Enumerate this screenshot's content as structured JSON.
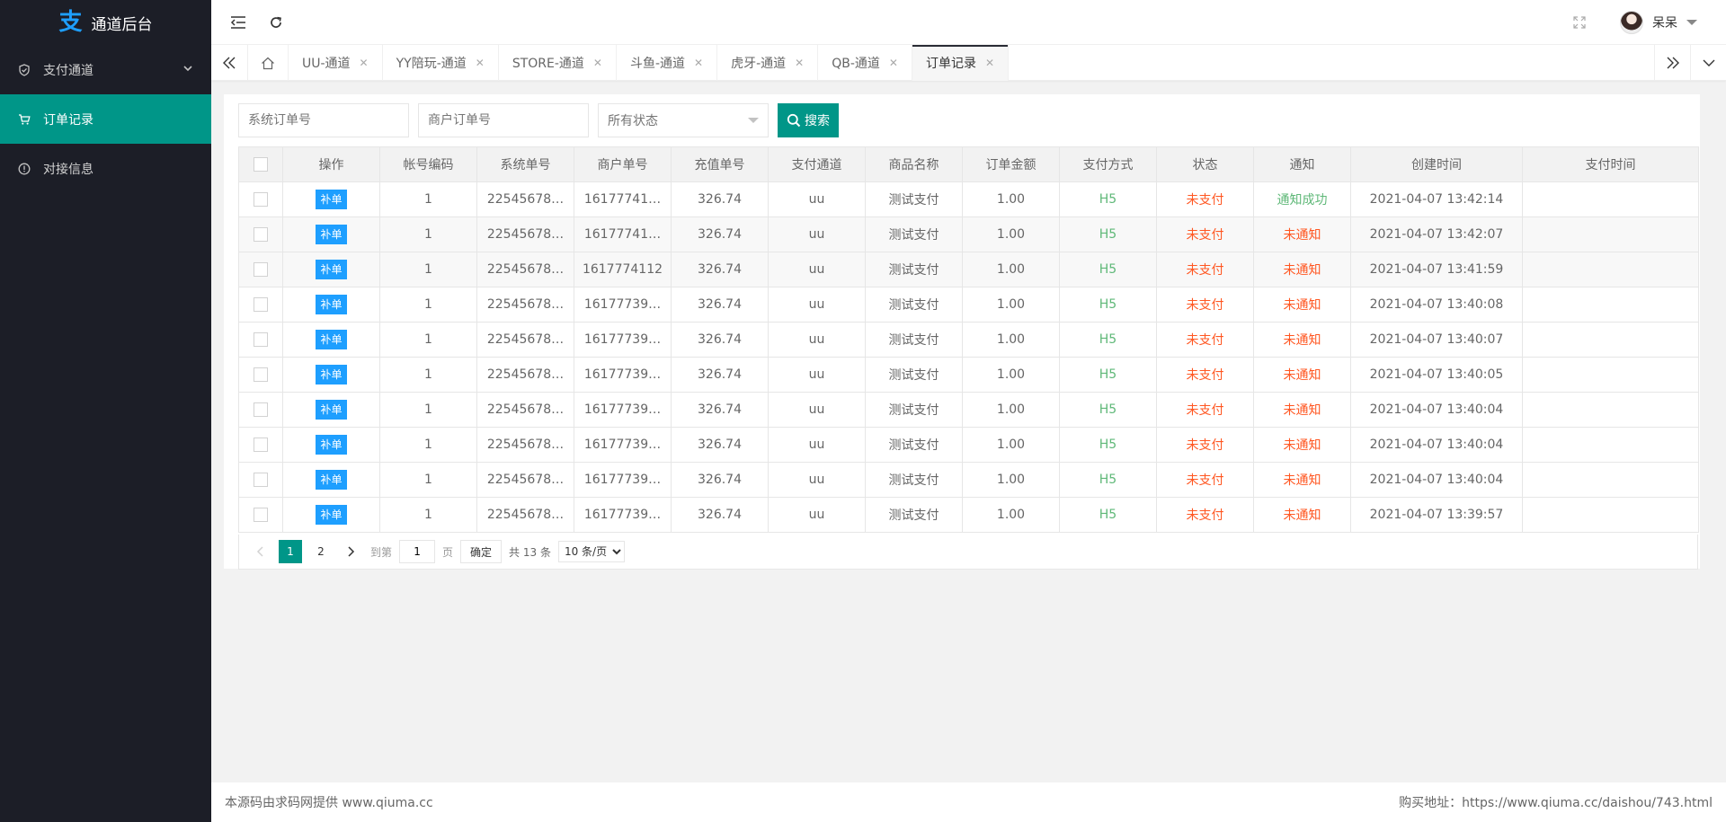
{
  "app": {
    "logo_glyph": "支",
    "title": "通道后台"
  },
  "sidebar": {
    "items": [
      {
        "label": "支付通道",
        "icon": "shield-check-icon",
        "has_children": true,
        "active": false
      },
      {
        "label": "订单记录",
        "icon": "cart-icon",
        "active": true
      },
      {
        "label": "对接信息",
        "icon": "info-circle-icon",
        "active": false
      }
    ]
  },
  "header": {
    "user_name": "呆呆",
    "icons": [
      "menu-fold-icon",
      "refresh-icon",
      "fullscreen-icon",
      "avatar"
    ]
  },
  "tabs": {
    "items": [
      {
        "label": "UU-通道"
      },
      {
        "label": "YY陪玩-通道"
      },
      {
        "label": "STORE-通道"
      },
      {
        "label": "斗鱼-通道"
      },
      {
        "label": "虎牙-通道"
      },
      {
        "label": "QB-通道"
      },
      {
        "label": "订单记录",
        "active": true
      }
    ],
    "close_glyph": "✕"
  },
  "search": {
    "system_order_placeholder": "系统订单号",
    "merchant_order_placeholder": "商户订单号",
    "status_select": "所有状态",
    "search_label": "搜索"
  },
  "table": {
    "columns": [
      "",
      "操作",
      "帐号编码",
      "系统单号",
      "商户单号",
      "充值单号",
      "支付通道",
      "商品名称",
      "订单金额",
      "支付方式",
      "状态",
      "通知",
      "创建时间",
      "支付时间"
    ],
    "action_label": "补单",
    "rows": [
      {
        "account": "1",
        "sys_no": "22545678…",
        "merchant_no": "16177741…",
        "recharge_no": "326.74",
        "channel": "uu",
        "product": "测试支付",
        "amount": "1.00",
        "pay_method": "H5",
        "status": "未支付",
        "notify": "通知成功",
        "created": "2021-04-07 13:42:14",
        "paid": ""
      },
      {
        "account": "1",
        "sys_no": "22545678…",
        "merchant_no": "16177741…",
        "recharge_no": "326.74",
        "channel": "uu",
        "product": "测试支付",
        "amount": "1.00",
        "pay_method": "H5",
        "status": "未支付",
        "notify": "未通知",
        "created": "2021-04-07 13:42:07",
        "paid": ""
      },
      {
        "account": "1",
        "sys_no": "22545678…",
        "merchant_no": "1617774112",
        "recharge_no": "326.74",
        "channel": "uu",
        "product": "测试支付",
        "amount": "1.00",
        "pay_method": "H5",
        "status": "未支付",
        "notify": "未通知",
        "created": "2021-04-07 13:41:59",
        "paid": ""
      },
      {
        "account": "1",
        "sys_no": "22545678…",
        "merchant_no": "16177739…",
        "recharge_no": "326.74",
        "channel": "uu",
        "product": "测试支付",
        "amount": "1.00",
        "pay_method": "H5",
        "status": "未支付",
        "notify": "未通知",
        "created": "2021-04-07 13:40:08",
        "paid": ""
      },
      {
        "account": "1",
        "sys_no": "22545678…",
        "merchant_no": "16177739…",
        "recharge_no": "326.74",
        "channel": "uu",
        "product": "测试支付",
        "amount": "1.00",
        "pay_method": "H5",
        "status": "未支付",
        "notify": "未通知",
        "created": "2021-04-07 13:40:07",
        "paid": ""
      },
      {
        "account": "1",
        "sys_no": "22545678…",
        "merchant_no": "16177739…",
        "recharge_no": "326.74",
        "channel": "uu",
        "product": "测试支付",
        "amount": "1.00",
        "pay_method": "H5",
        "status": "未支付",
        "notify": "未通知",
        "created": "2021-04-07 13:40:05",
        "paid": ""
      },
      {
        "account": "1",
        "sys_no": "22545678…",
        "merchant_no": "16177739…",
        "recharge_no": "326.74",
        "channel": "uu",
        "product": "测试支付",
        "amount": "1.00",
        "pay_method": "H5",
        "status": "未支付",
        "notify": "未通知",
        "created": "2021-04-07 13:40:04",
        "paid": ""
      },
      {
        "account": "1",
        "sys_no": "22545678…",
        "merchant_no": "16177739…",
        "recharge_no": "326.74",
        "channel": "uu",
        "product": "测试支付",
        "amount": "1.00",
        "pay_method": "H5",
        "status": "未支付",
        "notify": "未通知",
        "created": "2021-04-07 13:40:04",
        "paid": ""
      },
      {
        "account": "1",
        "sys_no": "22545678…",
        "merchant_no": "16177739…",
        "recharge_no": "326.74",
        "channel": "uu",
        "product": "测试支付",
        "amount": "1.00",
        "pay_method": "H5",
        "status": "未支付",
        "notify": "未通知",
        "created": "2021-04-07 13:40:04",
        "paid": ""
      },
      {
        "account": "1",
        "sys_no": "22545678…",
        "merchant_no": "16177739…",
        "recharge_no": "326.74",
        "channel": "uu",
        "product": "测试支付",
        "amount": "1.00",
        "pay_method": "H5",
        "status": "未支付",
        "notify": "未通知",
        "created": "2021-04-07 13:39:57",
        "paid": ""
      }
    ]
  },
  "pagination": {
    "pages": [
      "1",
      "2"
    ],
    "current": "1",
    "goto_label": "到第",
    "goto_value": "1",
    "page_unit": "页",
    "confirm_label": "确定",
    "total_label": "共 13 条",
    "limit_option": "10 条/页"
  },
  "footer": {
    "left": "本源码由求码网提供 www.qiuma.cc",
    "right": "购买地址：https://www.qiuma.cc/daishou/743.html"
  },
  "colors": {
    "sidebar_bg": "#1c1e27",
    "accent": "#009688",
    "action_blue": "#1e9fff",
    "success_green": "#5FB878",
    "warning_red": "#FF5722"
  }
}
